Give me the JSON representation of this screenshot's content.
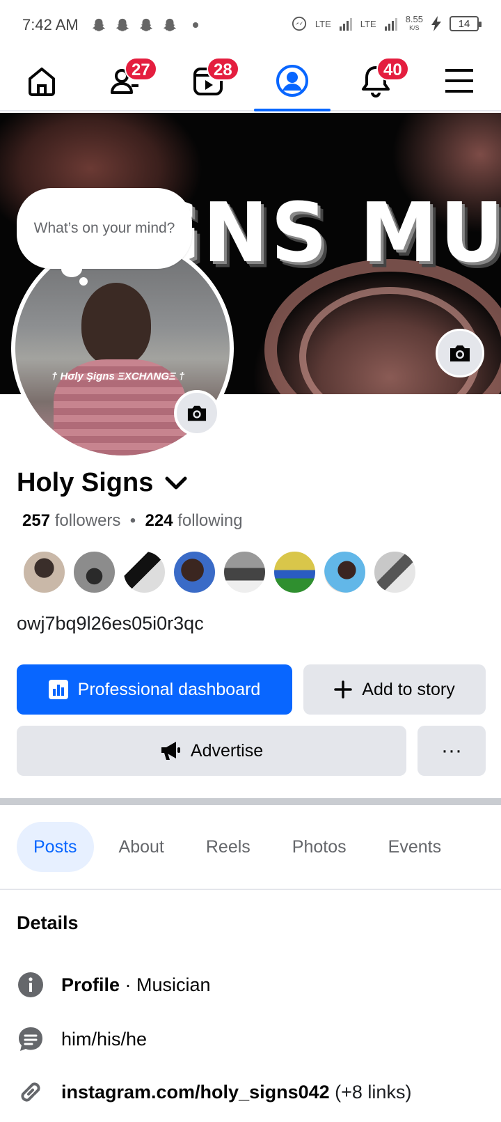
{
  "status_bar": {
    "time": "7:42 AM",
    "net1": "LTE",
    "net2": "LTE",
    "speed": "8.55",
    "speed_unit": "K/S",
    "battery": "14"
  },
  "nav": {
    "friends_badge": "27",
    "video_badge": "28",
    "notifications_badge": "40",
    "accent": "#0866ff",
    "badge_color": "#e41e3f"
  },
  "cover": {
    "text": "IGNS MUSIC"
  },
  "bubble": {
    "text": "What’s on your mind?"
  },
  "avatar": {
    "watermark": "† Hσly Şigns ΞXCHΛNGΞ †"
  },
  "profile": {
    "name": "Holy Signs",
    "followers_count": "257",
    "followers_label": "followers",
    "separator": "•",
    "following_count": "224",
    "following_label": "following",
    "bio": "owj7bq9l26es05i0r3qc"
  },
  "buttons": {
    "dashboard": "Professional dashboard",
    "story": "Add to story",
    "advertise": "Advertise",
    "more": "···"
  },
  "tabs": [
    "Posts",
    "About",
    "Reels",
    "Photos",
    "Events"
  ],
  "details": {
    "title": "Details",
    "profile_label": "Profile",
    "profile_value": " · Musician",
    "pronouns": "him/his/he",
    "link": "instagram.com/holy_signs042",
    "link_extra": " (+8 links)"
  }
}
